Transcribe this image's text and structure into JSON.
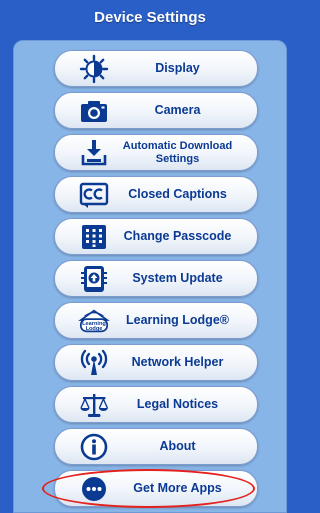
{
  "header": {
    "title": "Device Settings"
  },
  "menu": {
    "items": [
      {
        "label": "Display",
        "icon": "display-brightness-icon"
      },
      {
        "label": "Camera",
        "icon": "camera-icon"
      },
      {
        "label_line1": "Automatic Download",
        "label_line2": "Settings",
        "icon": "download-icon"
      },
      {
        "label": "Closed Captions",
        "icon": "closed-captions-icon"
      },
      {
        "label": "Change Passcode",
        "icon": "keypad-icon"
      },
      {
        "label": "System Update",
        "icon": "system-update-icon"
      },
      {
        "label": "Learning Lodge®",
        "icon": "learning-lodge-icon",
        "logo_text_1": "Learning",
        "logo_text_2": "Lodge"
      },
      {
        "label": "Network Helper",
        "icon": "wireless-antenna-icon"
      },
      {
        "label": "Legal Notices",
        "icon": "scales-icon"
      },
      {
        "label": "About",
        "icon": "info-icon"
      },
      {
        "label": "Get More Apps",
        "icon": "more-dots-icon"
      }
    ]
  },
  "colors": {
    "background": "#2a5fc8",
    "panel": "#88b5e8",
    "text": "#0b3a93",
    "highlight": "#e3211d"
  }
}
